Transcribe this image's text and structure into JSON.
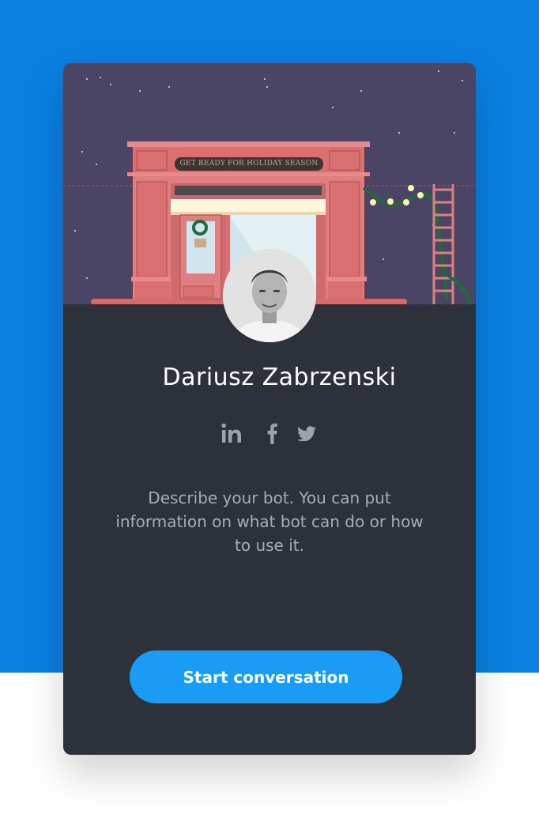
{
  "banner": {
    "sign_text": "GET READY FOR HOLIDAY SEASON"
  },
  "profile": {
    "name": "Dariusz Zabrzenski",
    "avatar": "portrait-photo"
  },
  "socials": [
    {
      "icon": "linkedin-icon",
      "glyph": "in"
    },
    {
      "icon": "facebook-icon",
      "glyph": "f"
    },
    {
      "icon": "twitter-icon",
      "glyph": "bird"
    }
  ],
  "description": "Describe your bot. You can put information on what bot can do or how to use it.",
  "cta": {
    "label": "Start conversation"
  },
  "colors": {
    "page_background": "#0a7fe0",
    "card_background": "#2c313a",
    "banner_sky": "#4b4565",
    "button": "#1a9cf5",
    "shop_red": "#e07f7f"
  }
}
